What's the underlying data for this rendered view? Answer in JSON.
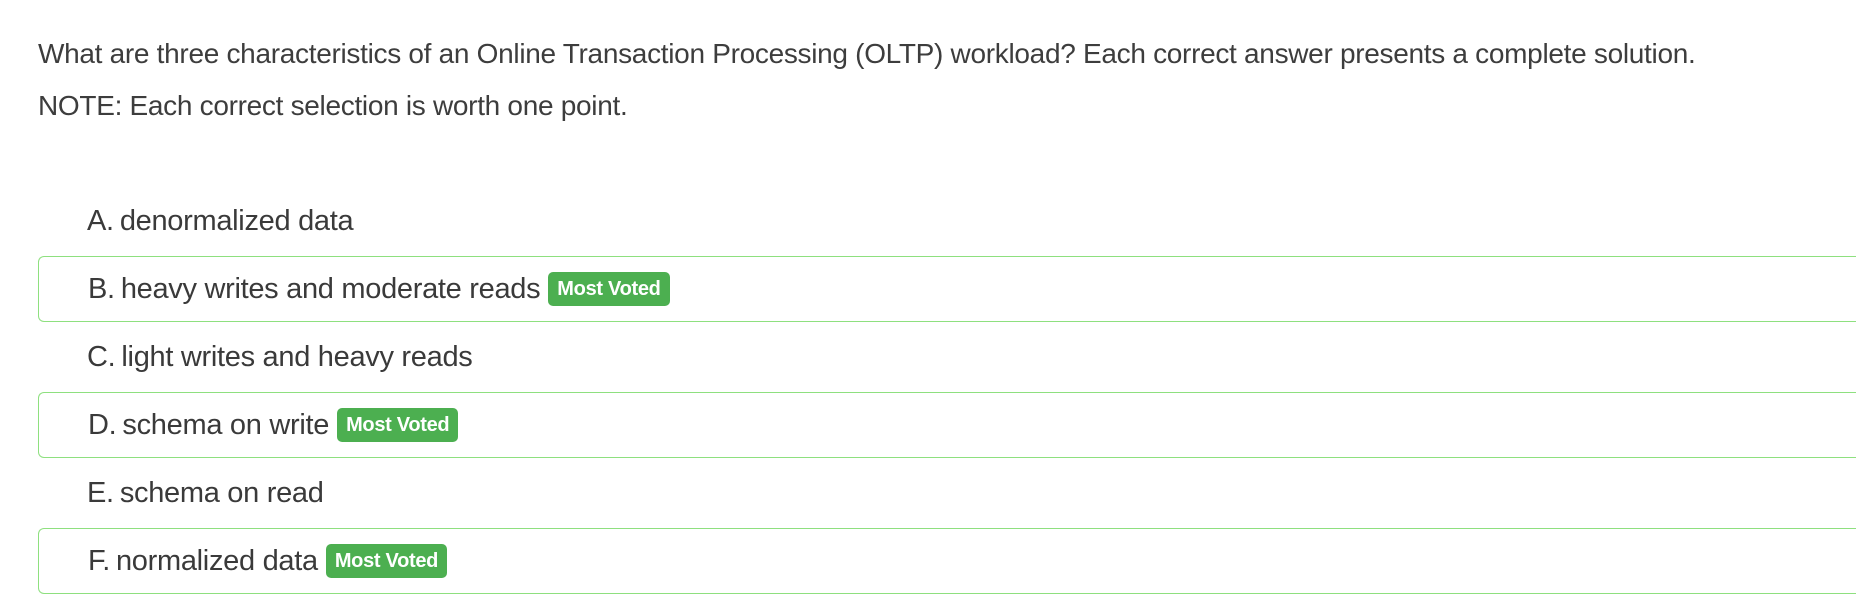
{
  "question": {
    "text": "What are three characteristics of an Online Transaction Processing (OLTP) workload? Each correct answer presents a complete solution.",
    "note": "NOTE: Each correct selection is worth one point."
  },
  "choices": [
    {
      "letter": "A.",
      "text": "denormalized data",
      "badge": ""
    },
    {
      "letter": "B.",
      "text": "heavy writes and moderate reads",
      "badge": "Most Voted"
    },
    {
      "letter": "C.",
      "text": "light writes and heavy reads",
      "badge": ""
    },
    {
      "letter": "D.",
      "text": "schema on write",
      "badge": "Most Voted"
    },
    {
      "letter": "E.",
      "text": "schema on read",
      "badge": ""
    },
    {
      "letter": "F.",
      "text": "normalized data",
      "badge": "Most Voted"
    }
  ],
  "colors": {
    "badge_bg": "#4caf50",
    "voted_border": "#8ee07f",
    "text": "#3c3c3c"
  }
}
